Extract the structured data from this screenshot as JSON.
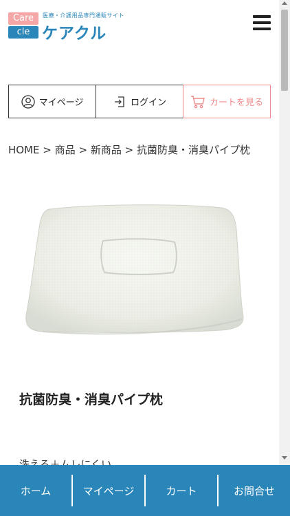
{
  "header": {
    "logo_top": "Care",
    "logo_bottom": "cle",
    "tagline": "医療・介護用品専門通販サイト",
    "site_name": "ケアクル",
    "menu_icon": "hamburger-icon"
  },
  "account": {
    "mypage_label": "マイページ",
    "login_label": "ログイン",
    "cart_label": "カートを見る",
    "mypage_icon": "user-icon",
    "login_icon": "login-icon",
    "cart_icon": "cart-icon",
    "cart_color": "#f08a8a"
  },
  "breadcrumb": {
    "items": [
      "HOME",
      "商品",
      "新商品",
      "抗菌防臭・消臭パイプ枕"
    ],
    "separator": ">"
  },
  "product": {
    "title": "抗菌防臭・消臭パイプ枕",
    "feature": "洗える＋ムレにくい"
  },
  "bottom_nav": {
    "items": [
      "ホーム",
      "マイページ",
      "カート",
      "お問合せ"
    ]
  },
  "colors": {
    "brand_blue": "#2a86b9",
    "brand_pink": "#f4a7a6"
  }
}
